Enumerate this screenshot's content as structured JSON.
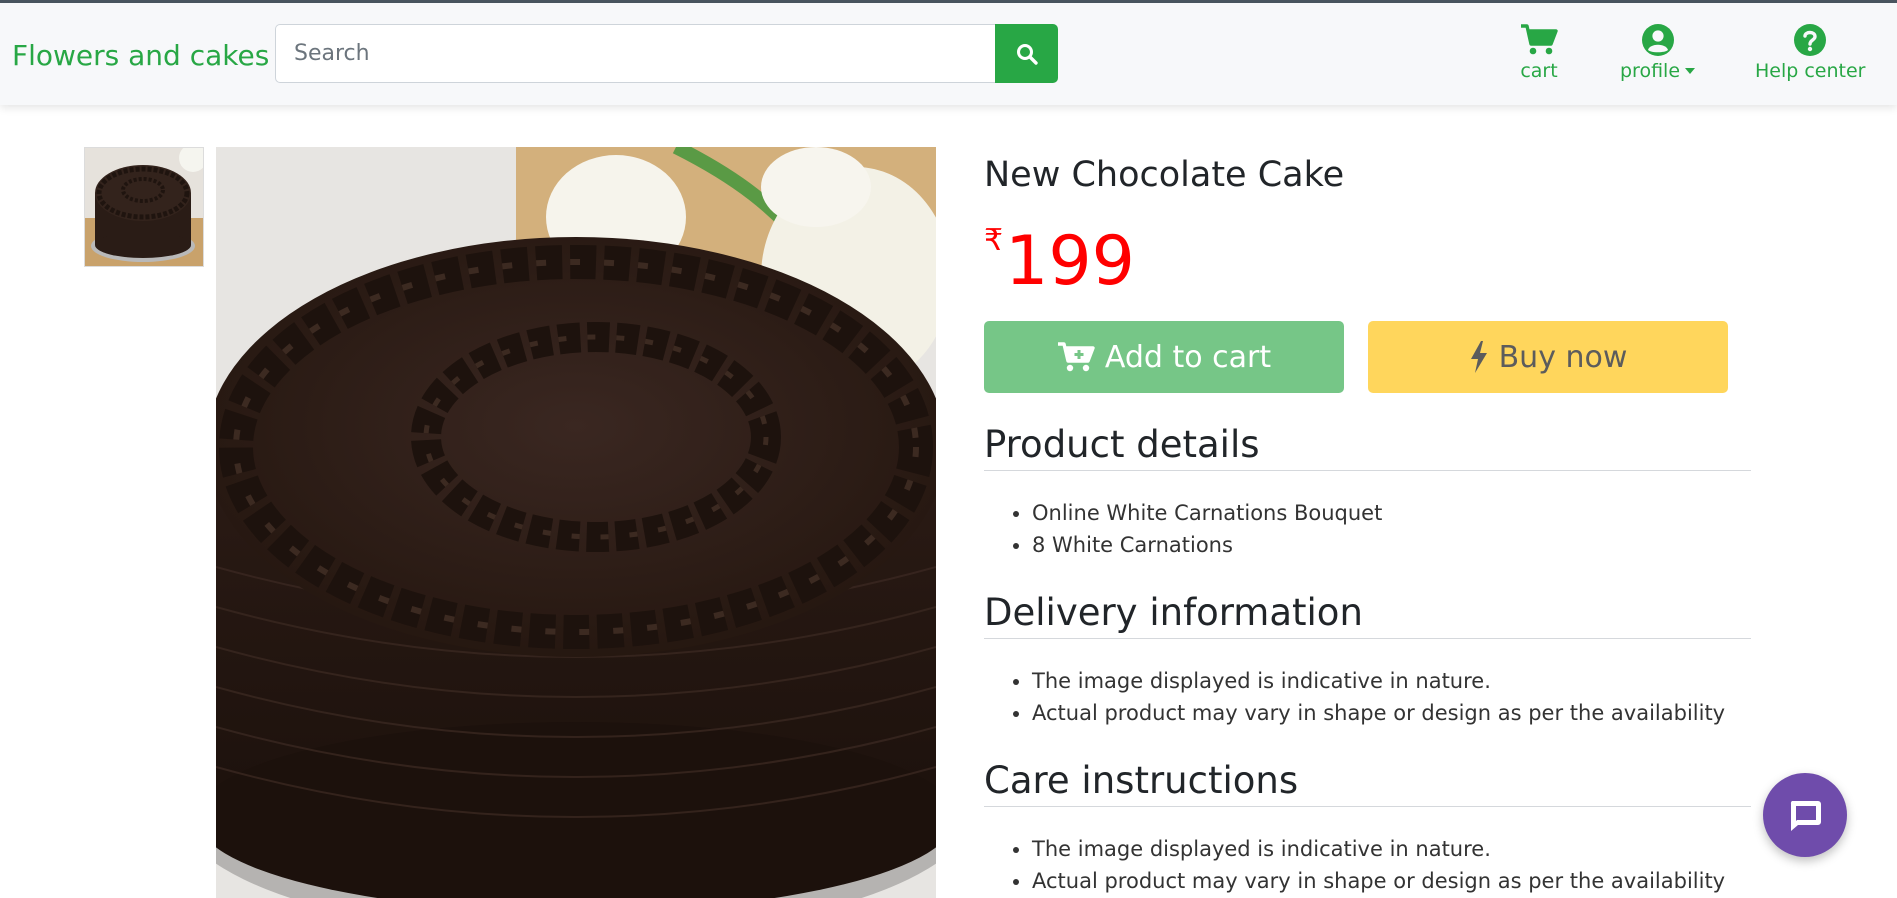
{
  "header": {
    "brand": "Flowers and cakes",
    "search": {
      "placeholder": "Search",
      "value": ""
    },
    "nav": {
      "cart": "cart",
      "profile": "profile",
      "help": "Help center"
    }
  },
  "product": {
    "title": "New Chocolate Cake",
    "currency_symbol": "₹",
    "price": "199",
    "add_to_cart_label": "Add to cart",
    "buy_now_label": "Buy now"
  },
  "sections": {
    "product_details": {
      "heading": "Product details",
      "items": [
        "Online White Carnations Bouquet",
        "8 White Carnations"
      ]
    },
    "delivery": {
      "heading": "Delivery information",
      "items": [
        "The image displayed is indicative in nature.",
        "Actual product may vary in shape or design as per the availability"
      ]
    },
    "care": {
      "heading": "Care instructions",
      "items": [
        "The image displayed is indicative in nature.",
        "Actual product may vary in shape or design as per the availability"
      ]
    }
  },
  "icons": {
    "search": "search-icon",
    "cart": "cart-icon",
    "profile": "user-circle-icon",
    "help": "question-circle-icon",
    "add_to_cart": "cart-plus-icon",
    "buy_now": "bolt-icon",
    "chat": "chat-icon"
  },
  "colors": {
    "brand_green": "#28a745",
    "add_to_cart_bg": "#76c687",
    "buy_now_bg": "#ffd65c",
    "price_red": "#ff0000",
    "chat_purple": "#6f4cab"
  }
}
